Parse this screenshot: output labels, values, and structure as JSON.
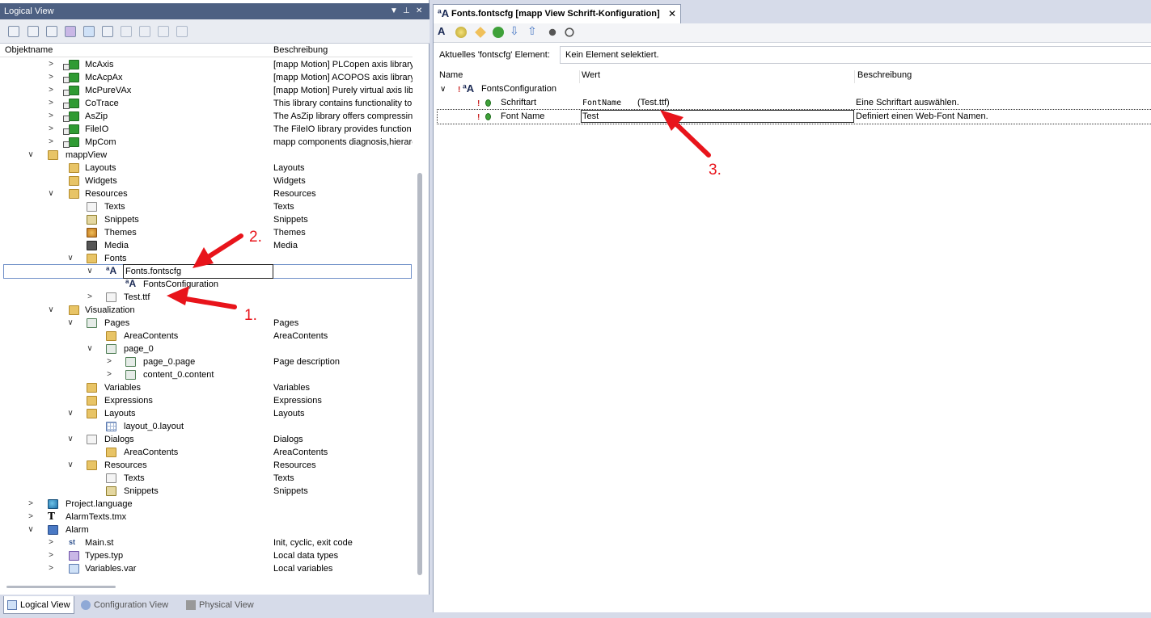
{
  "left_panel": {
    "title": "Logical View",
    "columns": {
      "name": "Objektname",
      "description": "Beschreibung"
    },
    "tree": [
      {
        "label": "McAxis",
        "desc": "[mapp Motion] PLCopen axis library",
        "icon": "library-icon"
      },
      {
        "label": "McAcpAx",
        "desc": "[mapp Motion] ACOPOS axis library",
        "icon": "library-icon"
      },
      {
        "label": "McPureVAx",
        "desc": "[mapp Motion] Purely virtual axis library",
        "icon": "library-icon"
      },
      {
        "label": "CoTrace",
        "desc": "This library contains functionality to e",
        "icon": "library-icon"
      },
      {
        "label": "AsZip",
        "desc": "The AsZip library offers compressing",
        "icon": "library-icon"
      },
      {
        "label": "FileIO",
        "desc": "The FileIO library provides function b",
        "icon": "library-icon"
      },
      {
        "label": "MpCom",
        "desc": "mapp components diagnosis,hierarch",
        "icon": "library-icon"
      },
      {
        "label": "mappView",
        "desc": "",
        "icon": "folder-icon"
      },
      {
        "label": "Layouts",
        "desc": "Layouts",
        "icon": "folder-icon"
      },
      {
        "label": "Widgets",
        "desc": "Widgets",
        "icon": "folder-icon"
      },
      {
        "label": "Resources",
        "desc": "Resources",
        "icon": "folder-icon"
      },
      {
        "label": "Texts",
        "desc": "Texts",
        "icon": "document-icon"
      },
      {
        "label": "Snippets",
        "desc": "Snippets",
        "icon": "snippets-icon"
      },
      {
        "label": "Themes",
        "desc": "Themes",
        "icon": "themes-icon"
      },
      {
        "label": "Media",
        "desc": "Media",
        "icon": "media-icon"
      },
      {
        "label": "Fonts",
        "desc": "",
        "icon": "folder-icon"
      },
      {
        "label": "Fonts.fontscfg",
        "desc": "",
        "icon": "font-config-icon"
      },
      {
        "label": "FontsConfiguration",
        "desc": "",
        "icon": "font-config-icon"
      },
      {
        "label": "Test.ttf",
        "desc": "",
        "icon": "document-icon"
      },
      {
        "label": "Visualization",
        "desc": "",
        "icon": "folder-icon"
      },
      {
        "label": "Pages",
        "desc": "Pages",
        "icon": "page-icon"
      },
      {
        "label": "AreaContents",
        "desc": "AreaContents",
        "icon": "folder-icon"
      },
      {
        "label": "page_0",
        "desc": "",
        "icon": "page-icon"
      },
      {
        "label": "page_0.page",
        "desc": "Page description",
        "icon": "page-icon"
      },
      {
        "label": "content_0.content",
        "desc": "",
        "icon": "page-icon"
      },
      {
        "label": "Variables",
        "desc": "Variables",
        "icon": "folder-icon"
      },
      {
        "label": "Expressions",
        "desc": "Expressions",
        "icon": "folder-icon"
      },
      {
        "label": "Layouts",
        "desc": "Layouts",
        "icon": "folder-icon"
      },
      {
        "label": "layout_0.layout",
        "desc": "",
        "icon": "grid-icon"
      },
      {
        "label": "Dialogs",
        "desc": "Dialogs",
        "icon": "document-icon"
      },
      {
        "label": "AreaContents",
        "desc": "AreaContents",
        "icon": "folder-icon"
      },
      {
        "label": "Resources",
        "desc": "Resources",
        "icon": "folder-icon"
      },
      {
        "label": "Texts",
        "desc": "Texts",
        "icon": "document-icon"
      },
      {
        "label": "Snippets",
        "desc": "Snippets",
        "icon": "snippets-icon"
      },
      {
        "label": "Project.language",
        "desc": "",
        "icon": "globe-icon"
      },
      {
        "label": "AlarmTexts.tmx",
        "desc": "",
        "icon": "text-icon"
      },
      {
        "label": "Alarm",
        "desc": "",
        "icon": "alarm-icon"
      },
      {
        "label": "Main.st",
        "desc": "Init, cyclic, exit code",
        "icon": "st-icon"
      },
      {
        "label": "Types.typ",
        "desc": "Local data types",
        "icon": "types-icon"
      },
      {
        "label": "Variables.var",
        "desc": "Local variables",
        "icon": "variables-icon"
      }
    ],
    "bottom_tabs": [
      "Logical View",
      "Configuration View",
      "Physical View"
    ]
  },
  "right_panel": {
    "tab_title": "Fonts.fontscfg [mapp View Schrift-Konfiguration]",
    "current_element_label": "Aktuelles 'fontscfg' Element:",
    "current_element_value": "Kein Element selektiert.",
    "grid_columns": {
      "name": "Name",
      "value": "Wert",
      "description": "Beschreibung"
    },
    "rows": [
      {
        "name": "FontsConfiguration",
        "value": "",
        "value_suffix": "",
        "description": ""
      },
      {
        "name": "Schriftart",
        "value": "FontName",
        "value_suffix": "(Test.ttf)",
        "description": "Eine Schriftart auswählen."
      },
      {
        "name": "Font Name",
        "value": "Test",
        "value_suffix": "",
        "description": "Definiert einen Web-Font Namen."
      }
    ]
  },
  "annotations": [
    "1.",
    "2.",
    "3."
  ],
  "colors": {
    "arrow": "#e8141b",
    "title_bar": "#4d6082",
    "selection": "#6f8fc7"
  }
}
